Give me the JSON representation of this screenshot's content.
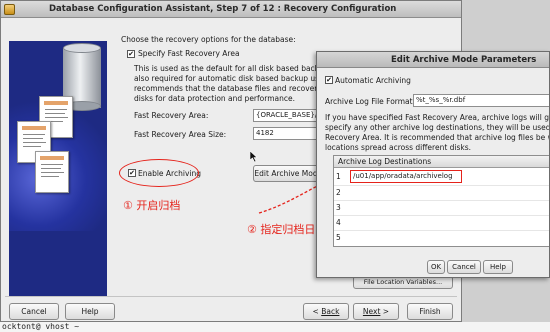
{
  "main_window": {
    "title": "Database Configuration Assistant, Step 7 of 12 : Recovery Configuration",
    "instruction": "Choose the recovery options for the database:",
    "specify_fra_label": "Specify Fast Recovery Area",
    "specify_fra_checked": true,
    "fra_description": [
      "This is used as the default for all disk based backu",
      "also required for automatic disk based backup usin",
      "recommends that the database files and recovery fil",
      "disks for data protection and performance."
    ],
    "fra_label": "Fast Recovery Area:",
    "fra_value": "{ORACLE_BASE}/fa",
    "fra_size_label": "Fast Recovery Area Size:",
    "fra_size_value": "4182",
    "enable_archiving_label": "Enable Archiving",
    "enable_archiving_checked": true,
    "edit_archive_button": "Edit Archive Mod",
    "file_location_button": "File Location Variables...",
    "cancel_button": "Cancel",
    "help_button": "Help",
    "back_button": "Back",
    "next_button": "Next",
    "finish_button": "Finish"
  },
  "dialog": {
    "title": "Edit Archive Mode Parameters",
    "automatic_archiving_label": "Automatic Archiving",
    "automatic_archiving_checked": true,
    "log_format_label": "Archive Log File Format",
    "log_format_value": "%t_%s_%r.dbf",
    "info_text": [
      "If you have specified Fast Recovery Area, archive logs will go th",
      "specify any other archive log destinations, they will be used inst",
      "Recovery Area. It is recommended that archive log files be writt",
      "locations spread across different disks."
    ],
    "destinations_header": "Archive Log Destinations",
    "destinations": [
      {
        "row": "1",
        "path": "/u01/app/oradata/archivelog"
      },
      {
        "row": "2",
        "path": ""
      },
      {
        "row": "3",
        "path": ""
      },
      {
        "row": "4",
        "path": ""
      },
      {
        "row": "5",
        "path": ""
      }
    ],
    "ok_button": "OK",
    "cancel_button": "Cancel",
    "help_button": "Help"
  },
  "annotations": {
    "step1": "① 开启归档",
    "step2": "② 指定归档日志存放位置"
  },
  "terminal_line": "ocktont@ vhost ~",
  "colors": {
    "annotation_red": "#e5231b",
    "illustration_blue": "#1e2a83"
  }
}
